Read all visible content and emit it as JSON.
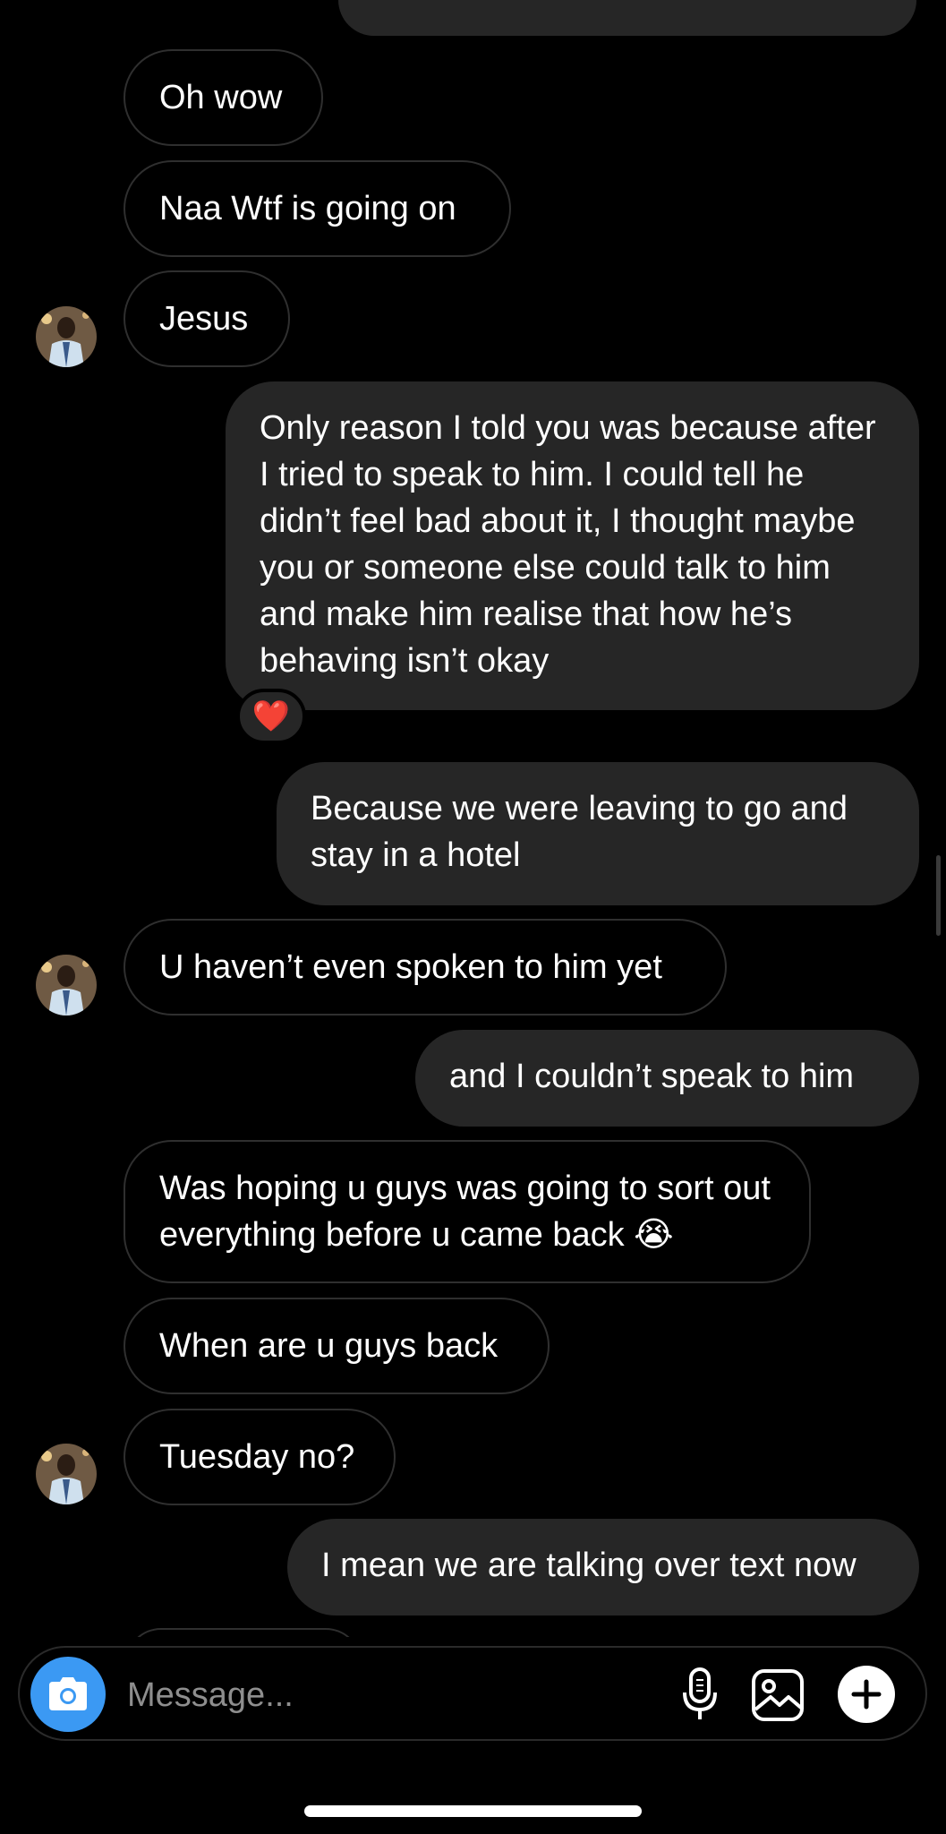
{
  "messages": [
    {
      "side": "received",
      "text": "Oh wow"
    },
    {
      "side": "received",
      "text": "Naa Wtf is going on"
    },
    {
      "side": "received",
      "text": "Jesus",
      "avatar": true
    },
    {
      "side": "sent",
      "text": "Only reason I told you was because after I tried to speak to him. I could tell he didn’t feel bad about it, I thought maybe you or someone else could talk to him and make him realise that how he’s behaving isn’t okay",
      "reaction": "❤️"
    },
    {
      "side": "sent",
      "text": "Because we were leaving to go and stay in a hotel"
    },
    {
      "side": "received",
      "text": "U haven’t even spoken to him yet",
      "avatar": true
    },
    {
      "side": "sent",
      "text": "and I couldn’t speak to him"
    },
    {
      "side": "received",
      "text": "Was hoping u guys was going to sort out everything before u came back 😭"
    },
    {
      "side": "received",
      "text": "When are u guys back"
    },
    {
      "side": "received",
      "text": "Tuesday no?",
      "avatar": true
    },
    {
      "side": "sent",
      "text": "I mean we are talking over text now"
    }
  ],
  "composer": {
    "placeholder": "Message...",
    "camera_icon": "camera-icon",
    "mic_icon": "microphone-icon",
    "gallery_icon": "gallery-icon",
    "plus_icon": "plus-icon"
  },
  "colors": {
    "background": "#000000",
    "sent_bubble": "#262626",
    "received_border": "#2f2f2f",
    "camera_button": "#3b99f3",
    "placeholder": "#8e8e8e"
  }
}
